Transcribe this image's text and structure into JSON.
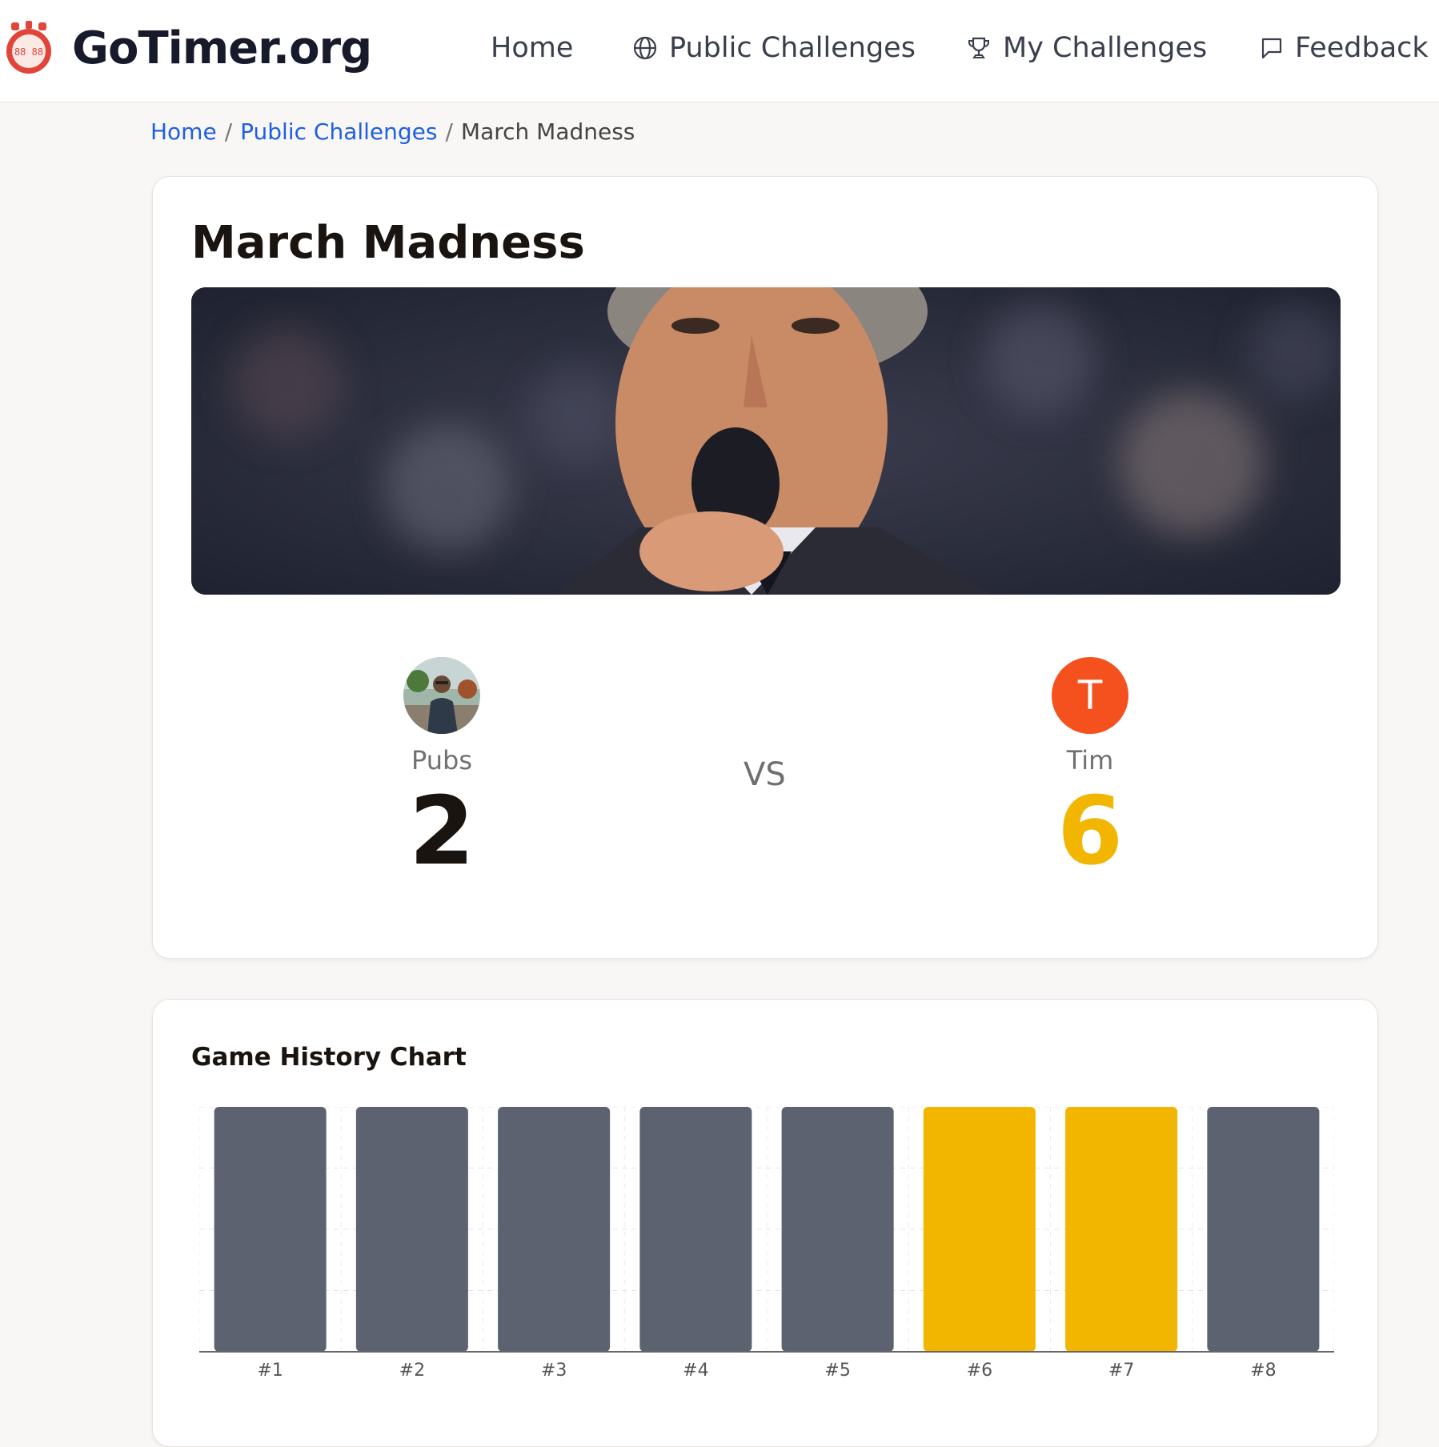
{
  "header": {
    "brand": "GoTimer.org",
    "nav": [
      {
        "label": "Home",
        "icon": "none"
      },
      {
        "label": "Public Challenges",
        "icon": "globe-icon"
      },
      {
        "label": "My Challenges",
        "icon": "trophy-icon"
      },
      {
        "label": "Feedback",
        "icon": "chat-bubble-icon"
      }
    ]
  },
  "breadcrumb": {
    "home": "Home",
    "section": "Public Challenges",
    "current": "March Madness",
    "separator": "/"
  },
  "challenge": {
    "title": "March Madness",
    "vs": "VS",
    "players": [
      {
        "name": "Pubs",
        "score": "2",
        "avatar": "photo"
      },
      {
        "name": "Tim",
        "score": "6",
        "avatar_letter": "T",
        "avatar_color": "#f4511e"
      }
    ]
  },
  "chart_card": {
    "title": "Game History Chart"
  },
  "colors": {
    "accent_blue": "#1f5fe0",
    "winner_yellow": "#f2b600",
    "bar_gray": "#5c6270",
    "avatar_orange": "#f4511e"
  },
  "chart_data": {
    "type": "bar",
    "categories": [
      "#1",
      "#2",
      "#3",
      "#4",
      "#5",
      "#6",
      "#7",
      "#8"
    ],
    "values": [
      1,
      1,
      1,
      1,
      1,
      1,
      1,
      1
    ],
    "bar_colors": [
      "#5c6270",
      "#5c6270",
      "#5c6270",
      "#5c6270",
      "#5c6270",
      "#f2b600",
      "#f2b600",
      "#5c6270"
    ],
    "ylim": [
      0,
      1
    ],
    "grid": true,
    "title": "",
    "xlabel": "",
    "ylabel": ""
  }
}
